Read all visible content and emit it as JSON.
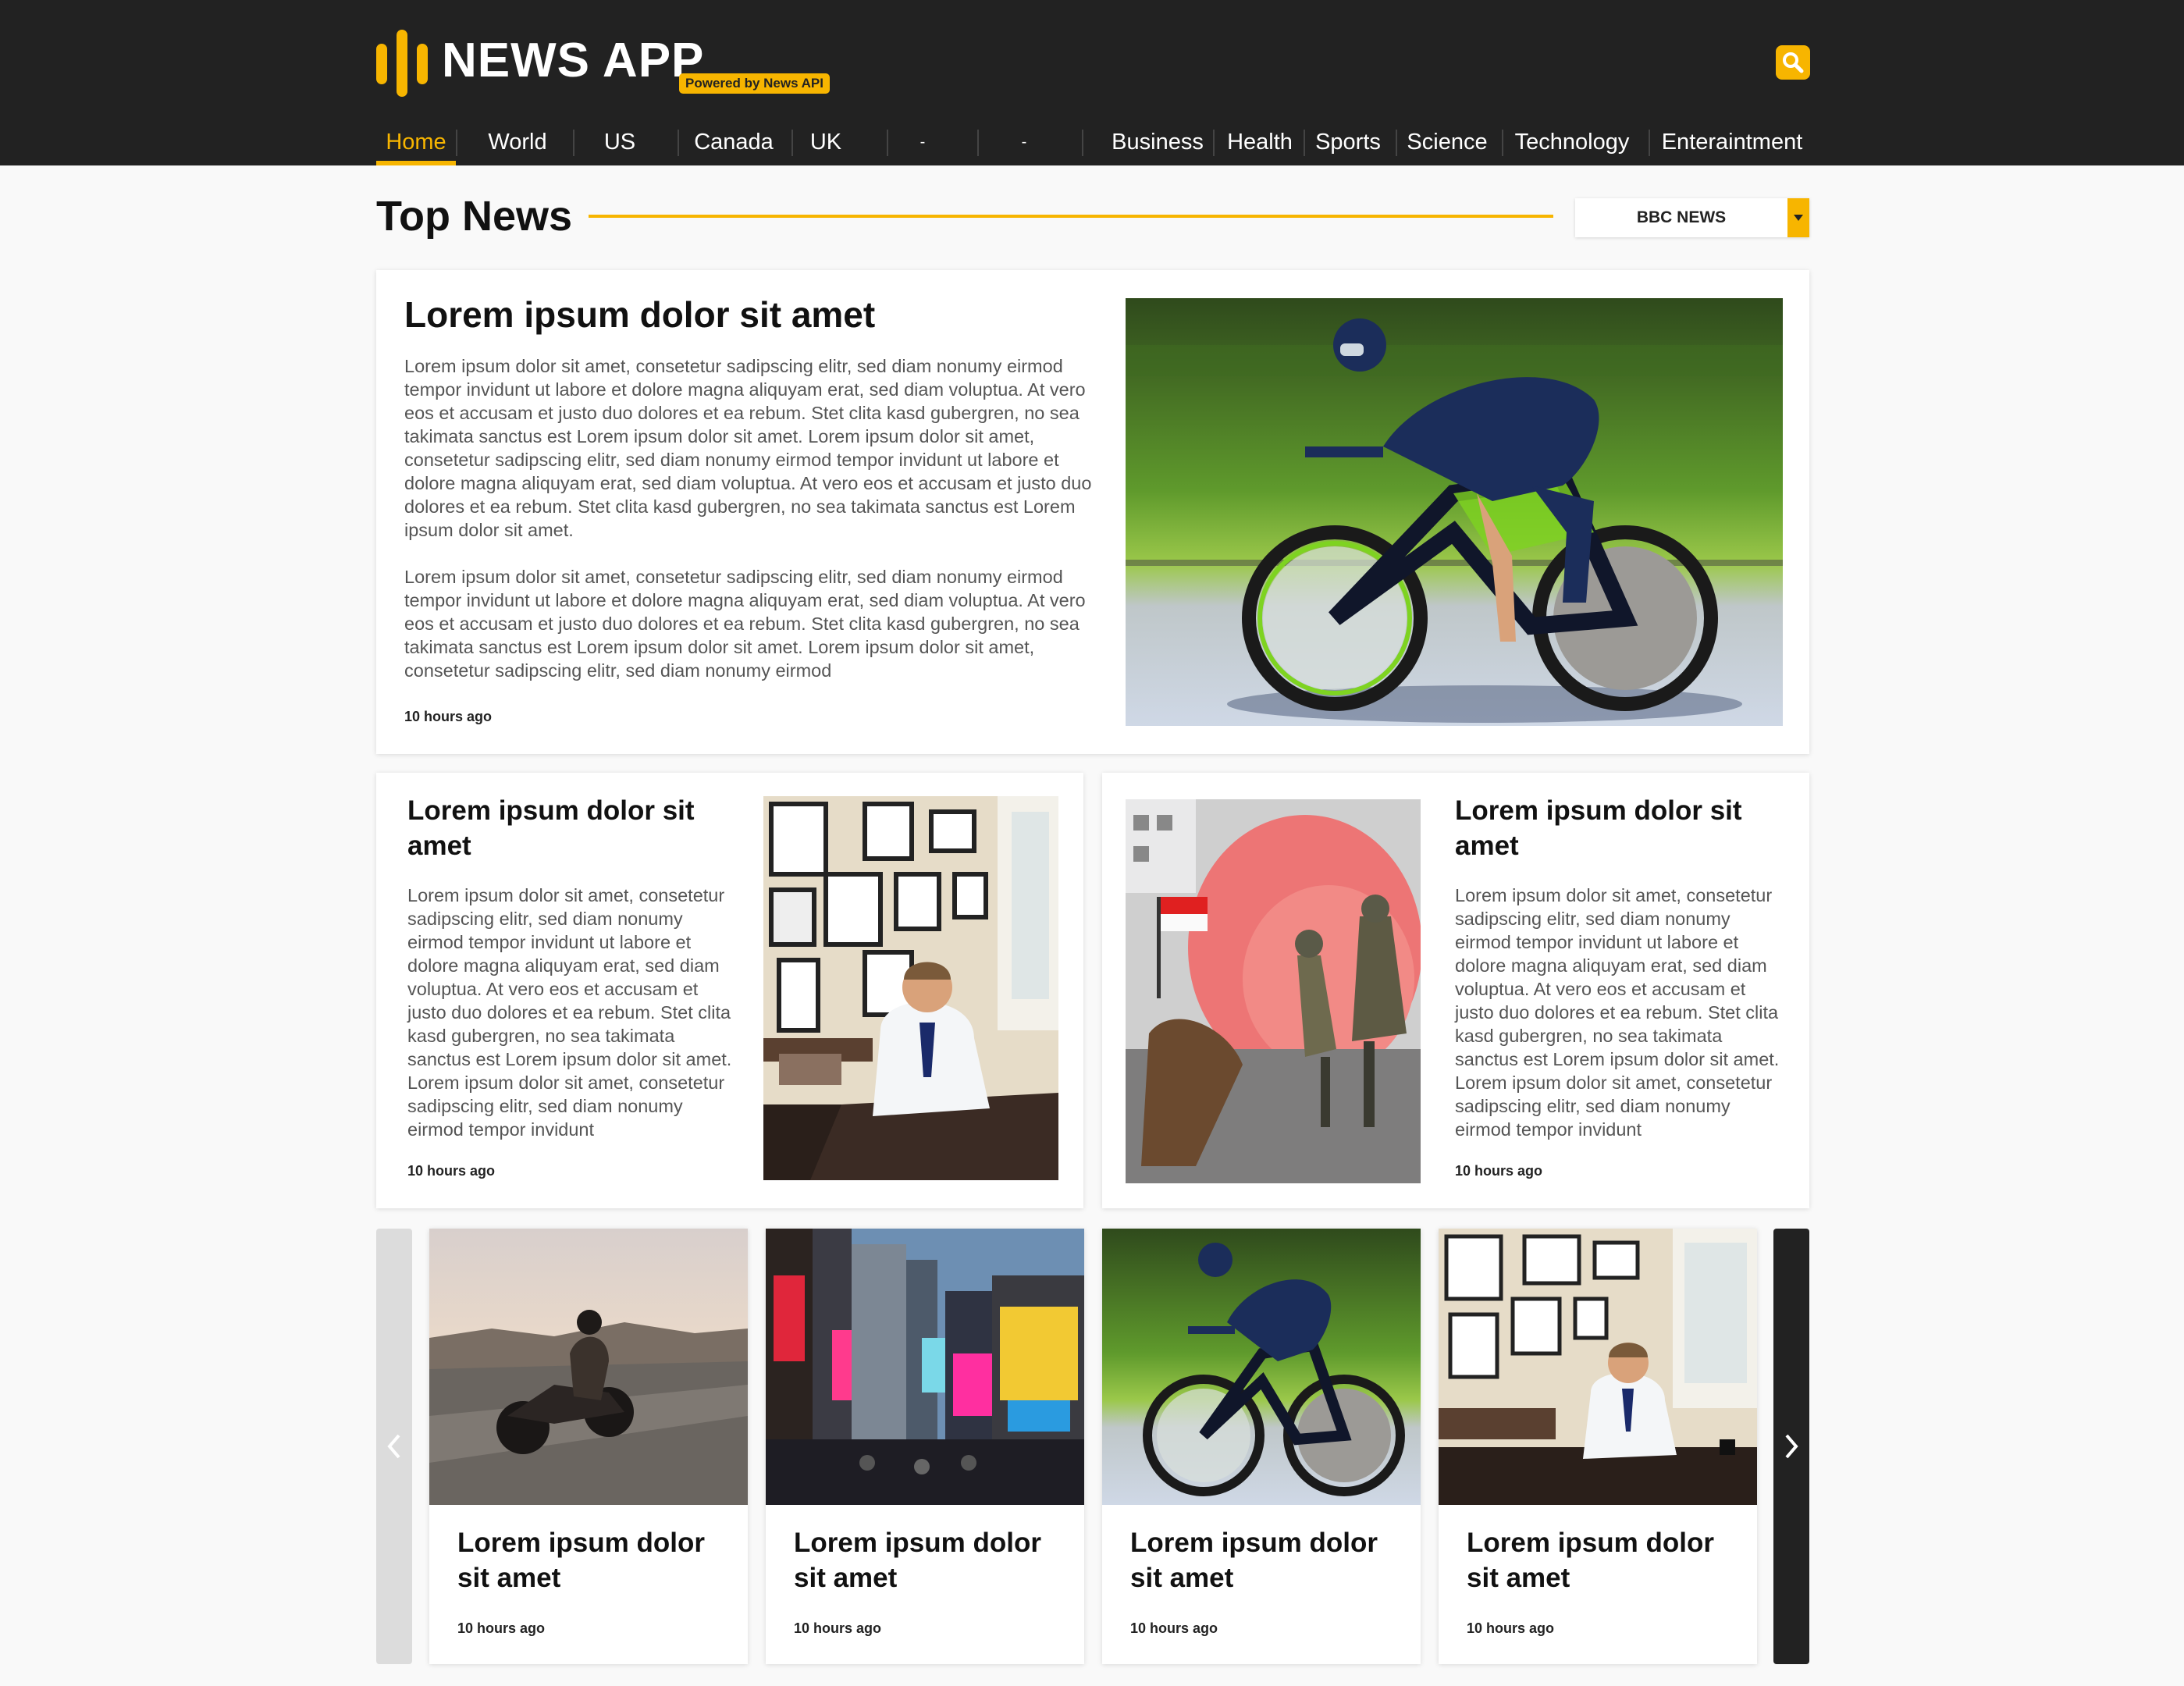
{
  "app": {
    "name": "NEWS APP",
    "badge": "Powered by News API"
  },
  "nav": {
    "items": [
      {
        "label": "Home",
        "active": true
      },
      {
        "label": "World"
      },
      {
        "label": "US"
      },
      {
        "label": "Canada"
      },
      {
        "label": "UK"
      },
      {
        "label": "-"
      },
      {
        "label": "-"
      },
      {
        "label": "Business"
      },
      {
        "label": "Health"
      },
      {
        "label": "Sports"
      },
      {
        "label": "Science"
      },
      {
        "label": "Technology"
      },
      {
        "label": "Enteraintment"
      }
    ]
  },
  "section": {
    "title": "Top News",
    "source": "BBC NEWS"
  },
  "featured": {
    "title": "Lorem ipsum dolor sit amet",
    "paragraphs": [
      "Lorem ipsum dolor sit amet, consetetur sadipscing elitr, sed diam nonumy eirmod tempor invidunt ut labore et dolore magna aliquyam erat, sed diam voluptua. At vero eos et accusam et justo duo dolores et ea rebum. Stet clita kasd gubergren, no sea takimata sanctus est Lorem ipsum dolor sit amet. Lorem ipsum dolor sit amet, consetetur sadipscing elitr, sed diam nonumy eirmod tempor invidunt ut labore et dolore magna aliquyam erat, sed diam voluptua. At vero eos et accusam et justo duo dolores et ea rebum. Stet clita kasd gubergren, no sea takimata sanctus est Lorem ipsum dolor sit amet.",
      "Lorem ipsum dolor sit amet, consetetur sadipscing elitr, sed diam nonumy eirmod tempor invidunt ut labore et dolore magna aliquyam erat, sed diam voluptua. At vero eos et accusam et justo duo dolores et ea rebum. Stet clita kasd gubergren, no sea takimata sanctus est Lorem ipsum dolor sit amet. Lorem ipsum dolor sit amet, consetetur sadipscing elitr, sed diam nonumy eirmod"
    ],
    "time": "10 hours ago"
  },
  "secondary": [
    {
      "title": "Lorem ipsum dolor sit amet",
      "body": "Lorem ipsum dolor sit amet, consetetur sadipscing elitr, sed diam nonumy eirmod tempor invidunt ut labore et dolore magna aliquyam erat, sed diam voluptua. At vero eos et accusam et justo duo dolores et ea rebum. Stet clita kasd gubergren, no sea takimata sanctus est Lorem ipsum dolor sit amet. Lorem ipsum dolor sit amet, consetetur sadipscing elitr, sed diam nonumy eirmod tempor invidunt",
      "time": "10 hours ago"
    },
    {
      "title": "Lorem ipsum dolor sit amet",
      "body": "Lorem ipsum dolor sit amet, consetetur sadipscing elitr, sed diam nonumy eirmod tempor invidunt ut labore et dolore magna aliquyam erat, sed diam voluptua. At vero eos et accusam et justo duo dolores et ea rebum. Stet clita kasd gubergren, no sea takimata sanctus est Lorem ipsum dolor sit amet. Lorem ipsum dolor sit amet, consetetur sadipscing elitr, sed diam nonumy eirmod tempor invidunt",
      "time": "10 hours ago"
    }
  ],
  "carousel": [
    {
      "title": "Lorem ipsum dolor sit amet",
      "time": "10 hours ago"
    },
    {
      "title": "Lorem ipsum dolor sit amet",
      "time": "10 hours ago"
    },
    {
      "title": "Lorem ipsum dolor sit amet",
      "time": "10 hours ago"
    },
    {
      "title": "Lorem ipsum dolor sit amet",
      "time": "10 hours ago"
    }
  ],
  "icons": {
    "search": "search-icon",
    "dropdown": "chevron-down-icon",
    "prev": "chevron-left-icon",
    "next": "chevron-right-icon"
  },
  "colors": {
    "accent": "#f7b500",
    "header_bg": "#222222",
    "page_bg": "#f9f9f9"
  }
}
